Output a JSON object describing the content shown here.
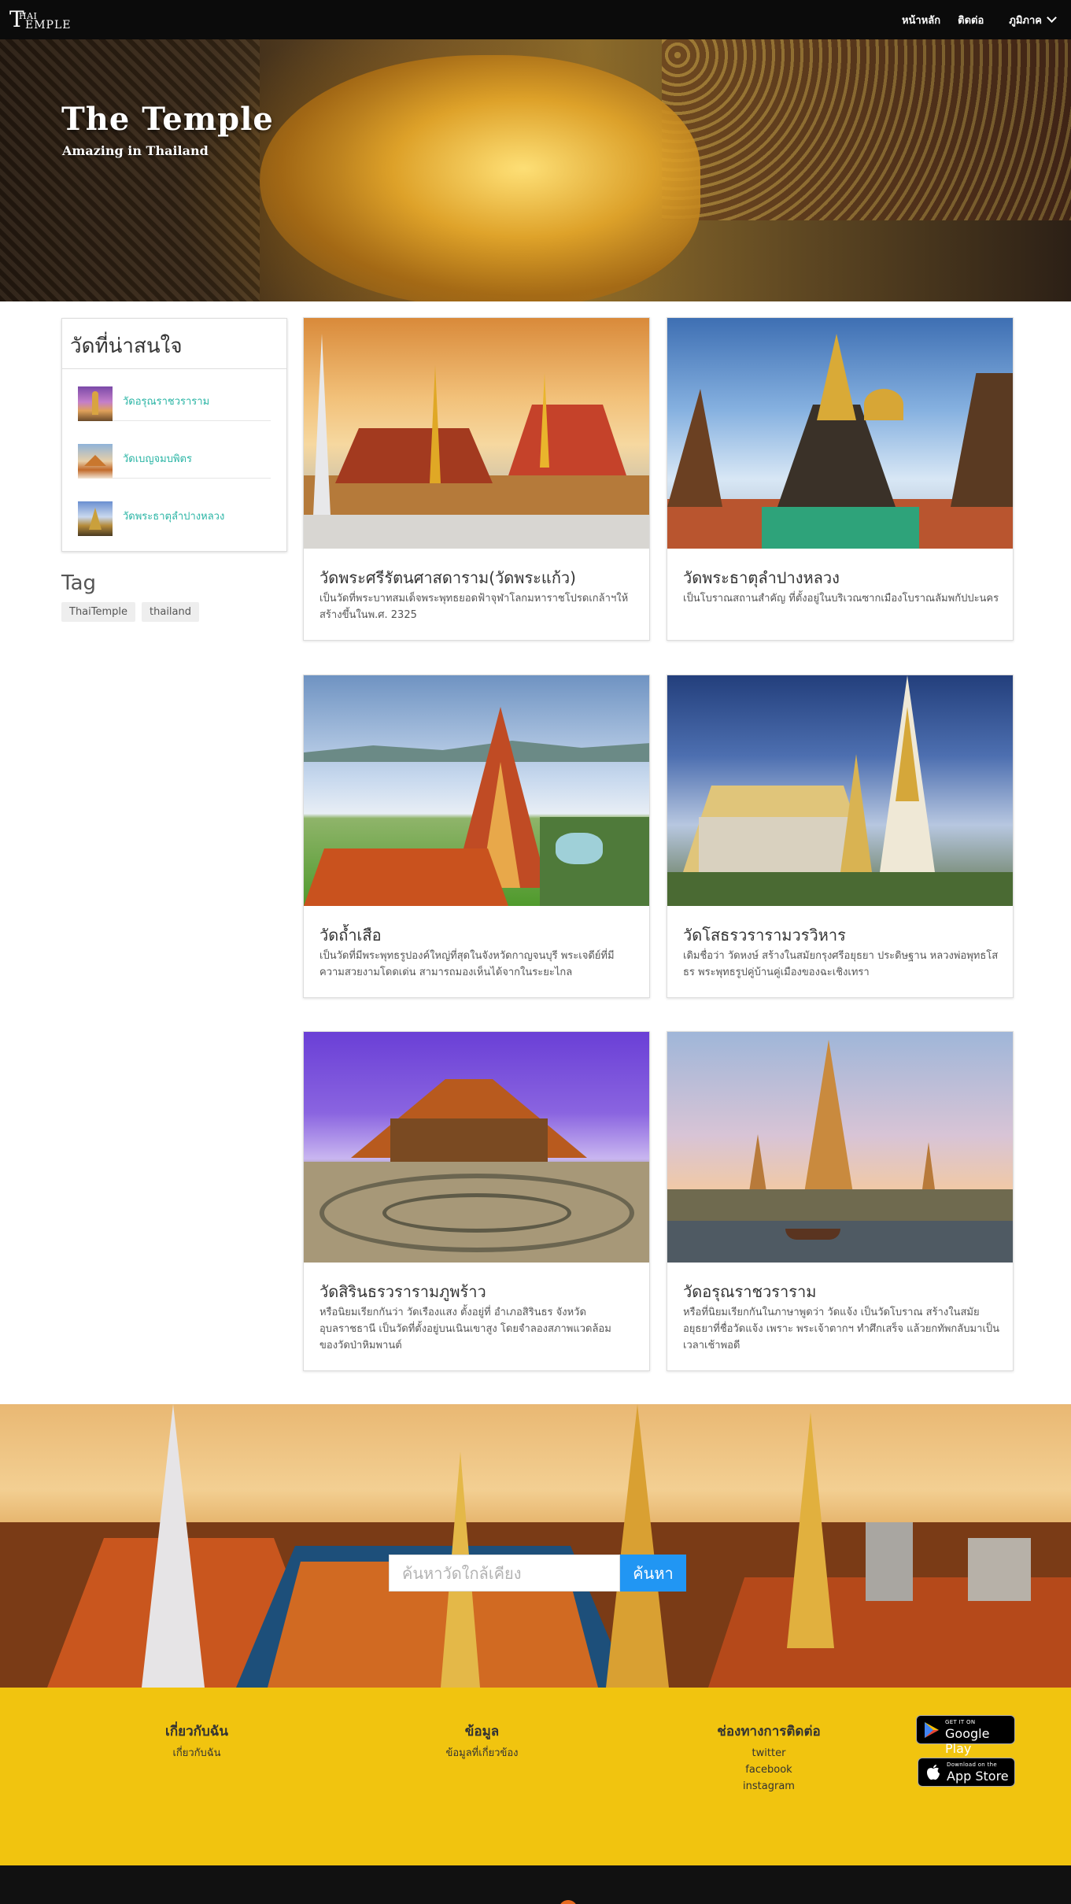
{
  "nav": {
    "logo_big": "T",
    "logo_small_top": "HAI",
    "logo_small_bottom": "EMPLE",
    "home": "หน้าหลัก",
    "contact": "ติดต่อ",
    "region": "ภูมิภาค"
  },
  "hero": {
    "title": "The Temple",
    "subtitle": "Amazing in Thailand"
  },
  "sidebar": {
    "title": "วัดที่น่าสนใจ",
    "items": [
      {
        "label": "วัดอรุณราชวราราม"
      },
      {
        "label": "วัดเบญจมบพิตร"
      },
      {
        "label": "วัดพระธาตุลำปางหลวง"
      }
    ],
    "tag_title": "Tag",
    "tags": [
      "ThaiTemple",
      "thailand"
    ]
  },
  "cards": [
    {
      "title": "วัดพระศรีรัตนศาสดาราม(วัดพระแก้ว)",
      "desc": "เป็นวัดที่พระบาทสมเด็จพระพุทธยอดฟ้าจุฬาโลกมหาราชโปรดเกล้าฯให้สร้างขึ้นในพ.ศ. 2325"
    },
    {
      "title": "วัดพระธาตุลำปางหลวง",
      "desc": "เป็นโบราณสถานสำคัญ ที่ตั้งอยู่ในบริเวณซากเมืองโบราณลัมพกัปปะนคร"
    },
    {
      "title": "วัดถ้ำเสือ",
      "desc": "เป็นวัดที่มีพระพุทธรูปองค์ใหญ่ที่สุดในจังหวัดกาญจนบุรี พระเจดีย์ที่มีความสวยงามโดดเด่น สามารถมองเห็นได้จากในระยะไกล"
    },
    {
      "title": "วัดโสธรวรารามวรวิหาร",
      "desc": "เดิมชื่อว่า วัดหงษ์ สร้างในสมัยกรุงศรีอยุธยา ประดิษฐาน หลวงพ่อพุทธโสธร พระพุทธรูปคู่บ้านคู่เมืองของฉะเชิงเทรา"
    },
    {
      "title": "วัดสิรินธรวรารามภูพร้าว",
      "desc": "หรือนิยมเรียกกันว่า วัดเรืองแสง ตั้งอยู่ที่ อำเภอสิรินธร จังหวัดอุบลราชธานี เป็นวัดที่ตั้งอยู่บนเนินเขาสูง โดยจำลองสภาพแวดล้อมของวัดป่าหิมพานต์"
    },
    {
      "title": "วัดอรุณราชวราราม",
      "desc": "หรือที่นิยมเรียกกันในภาษาพูดว่า วัดแจ้ง เป็นวัดโบราณ สร้างในสมัยอยุธยาที่ชื่อวัดแจ้ง เพราะ พระเจ้าตากฯ ทำศึกเสร็จ แล้วยกทัพกลับมาเป็นเวลาเช้าพอดี"
    }
  ],
  "search": {
    "placeholder": "ค้นหาวัดใกล้เคียง",
    "button": "ค้นหา"
  },
  "footer": {
    "col1": {
      "heading": "เกี่ยวกับฉัน",
      "links": [
        "เกี่ยวกับฉัน"
      ]
    },
    "col2": {
      "heading": "ข้อมูล",
      "links": [
        "ข้อมูลที่เกี่ยวข้อง"
      ]
    },
    "col3": {
      "heading": "ช่องทางการติดต่อ",
      "links": [
        "twitter",
        "facebook",
        "instagram"
      ]
    },
    "google_play": {
      "small": "GET IT ON",
      "big": "Google Play"
    },
    "app_store": {
      "small": "Download on the",
      "big": "App Store"
    }
  },
  "colors": {
    "accent": "#2ab5a5",
    "search_button": "#2196f3",
    "footer_bg": "#f1c40f",
    "navbar_bg": "#0b0b0b"
  },
  "icons": [
    "chevron-down-icon",
    "google-play-icon",
    "apple-icon",
    "scroll-top-icon"
  ]
}
